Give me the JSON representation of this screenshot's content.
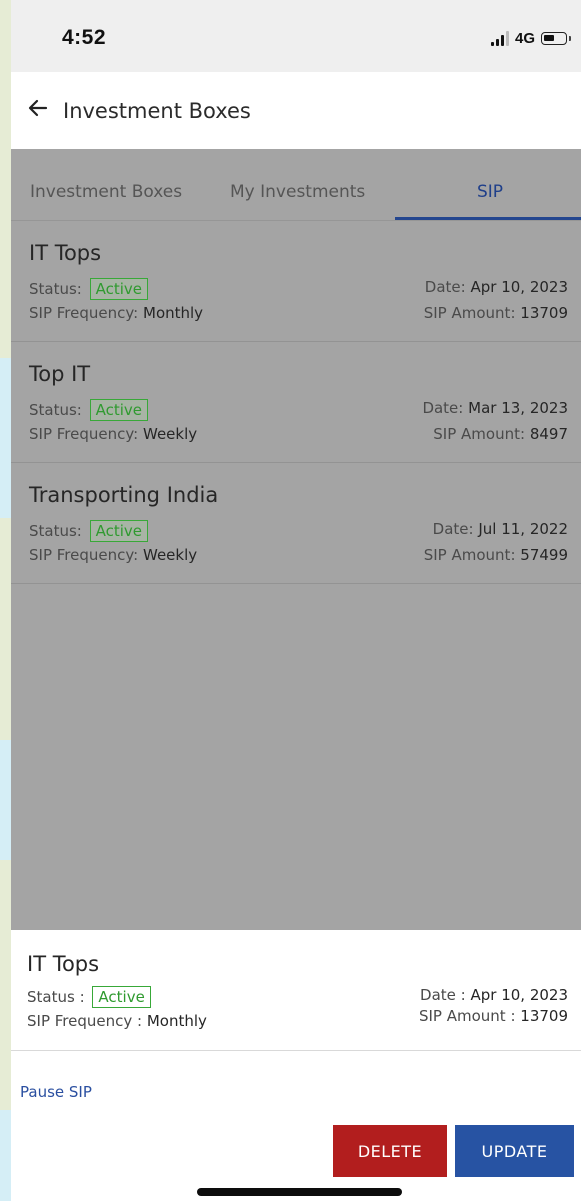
{
  "status_bar": {
    "time": "4:52",
    "network": "4G"
  },
  "header": {
    "title": "Investment Boxes"
  },
  "tabs": [
    {
      "label": "Investment Boxes"
    },
    {
      "label": "My Investments"
    },
    {
      "label": "SIP"
    }
  ],
  "sip_list": [
    {
      "name": "IT Tops",
      "status_label": "Status:",
      "status": "Active",
      "freq_label": "SIP Frequency:",
      "frequency": "Monthly",
      "date_label": "Date:",
      "date": "Apr 10, 2023",
      "amount_label": "SIP Amount:",
      "amount": "13709"
    },
    {
      "name": "Top IT",
      "status_label": "Status:",
      "status": "Active",
      "freq_label": "SIP Frequency:",
      "frequency": "Weekly",
      "date_label": "Date:",
      "date": "Mar 13, 2023",
      "amount_label": "SIP Amount:",
      "amount": "8497"
    },
    {
      "name": "Transporting India",
      "status_label": "Status:",
      "status": "Active",
      "freq_label": "SIP Frequency:",
      "frequency": "Weekly",
      "date_label": "Date:",
      "date": "Jul 11, 2022",
      "amount_label": "SIP Amount:",
      "amount": "57499"
    }
  ],
  "detail_sheet": {
    "name": "IT Tops",
    "status_label": "Status :",
    "status": "Active",
    "freq_label": "SIP Frequency :",
    "frequency": "Monthly",
    "date_label": "Date :",
    "date": "Apr 10, 2023",
    "amount_label": "SIP Amount :",
    "amount": "13709",
    "pause_link": "Pause SIP",
    "delete_button": "DELETE",
    "update_button": "UPDATE"
  },
  "icons": {
    "back": "arrow-left-icon",
    "signal": "signal-icon",
    "battery": "battery-icon"
  },
  "colors": {
    "active_tab": "#1f3f8a",
    "status_active": "#2f9a2f",
    "delete": "#b21e1e",
    "update": "#2753a3",
    "link": "#2a4fa0"
  }
}
